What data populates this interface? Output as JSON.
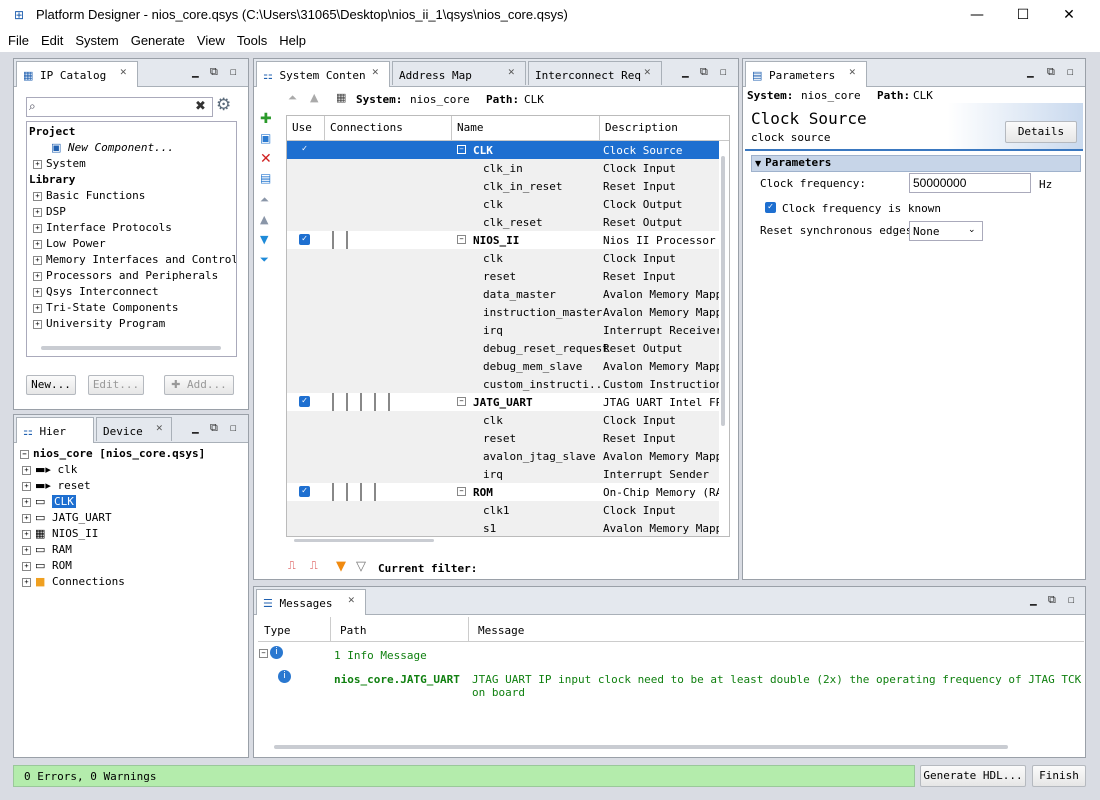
{
  "window": {
    "title": "Platform Designer - nios_core.qsys (C:\\Users\\31065\\Desktop\\nios_ii_1\\qsys\\nios_core.qsys)",
    "minimize": "—",
    "maximize": "☐",
    "close": "✕"
  },
  "menu": [
    "File",
    "Edit",
    "System",
    "Generate",
    "View",
    "Tools",
    "Help"
  ],
  "ip_catalog": {
    "tab": "IP Catalog",
    "search_placeholder": "",
    "project_heading": "Project",
    "new_component": "New Component...",
    "system": "System",
    "library_heading": "Library",
    "library_items": [
      "Basic Functions",
      "DSP",
      "Interface Protocols",
      "Low Power",
      "Memory Interfaces and Controllers",
      "Processors and Peripherals",
      "Qsys Interconnect",
      "Tri-State Components",
      "University Program"
    ],
    "buttons": {
      "new": "New...",
      "edit": "Edit...",
      "add": "Add..."
    }
  },
  "hierarchy": {
    "tabs": [
      "Hier",
      "Device"
    ],
    "root": "nios_core [nios_core.qsys]",
    "items": [
      "clk",
      "reset",
      "CLK",
      "JATG_UART",
      "NIOS_II",
      "RAM",
      "ROM",
      "Connections"
    ]
  },
  "system_contents": {
    "tabs": [
      "System Conten",
      "Address Map",
      "Interconnect Req"
    ],
    "system_label": "System:",
    "system_name": "nios_core",
    "path_label": "Path:",
    "path_value": "CLK",
    "columns": [
      "Use",
      "Connections",
      "Name",
      "Description"
    ],
    "rows": [
      {
        "use": true,
        "name": "CLK",
        "desc": "Clock Source",
        "module": true,
        "selected": true
      },
      {
        "use": false,
        "name": "clk_in",
        "desc": "Clock Input"
      },
      {
        "use": false,
        "name": "clk_in_reset",
        "desc": "Reset Input"
      },
      {
        "use": false,
        "name": "clk",
        "desc": "Clock Output"
      },
      {
        "use": false,
        "name": "clk_reset",
        "desc": "Reset Output"
      },
      {
        "use": true,
        "name": "NIOS_II",
        "desc": "Nios II Processor",
        "module": true
      },
      {
        "use": false,
        "name": "clk",
        "desc": "Clock Input"
      },
      {
        "use": false,
        "name": "reset",
        "desc": "Reset Input"
      },
      {
        "use": false,
        "name": "data_master",
        "desc": "Avalon Memory Mappe"
      },
      {
        "use": false,
        "name": "instruction_master",
        "desc": "Avalon Memory Mappe"
      },
      {
        "use": false,
        "name": "irq",
        "desc": "Interrupt Receiver"
      },
      {
        "use": false,
        "name": "debug_reset_request",
        "desc": "Reset Output"
      },
      {
        "use": false,
        "name": "debug_mem_slave",
        "desc": "Avalon Memory Mappe"
      },
      {
        "use": false,
        "name": "custom_instructi...",
        "desc": "Custom Instruction"
      },
      {
        "use": true,
        "name": "JATG_UART",
        "desc": "JTAG UART Intel FPG",
        "module": true
      },
      {
        "use": false,
        "name": "clk",
        "desc": "Clock Input"
      },
      {
        "use": false,
        "name": "reset",
        "desc": "Reset Input"
      },
      {
        "use": false,
        "name": "avalon_jtag_slave",
        "desc": "Avalon Memory Mappe"
      },
      {
        "use": false,
        "name": "irq",
        "desc": "Interrupt Sender"
      },
      {
        "use": true,
        "name": "ROM",
        "desc": "On-Chip Memory (RAM",
        "module": true
      },
      {
        "use": false,
        "name": "clk1",
        "desc": "Clock Input"
      },
      {
        "use": false,
        "name": "s1",
        "desc": "Avalon Memory Mappe"
      }
    ],
    "filter_label": "Current filter:"
  },
  "parameters": {
    "tab": "Parameters",
    "system_label": "System:",
    "system_name": "nios_core",
    "path_label": "Path:",
    "path_value": "CLK",
    "component_title": "Clock Source",
    "component_sub": "clock source",
    "details_button": "Details",
    "section": "Parameters",
    "clock_freq_label": "Clock frequency:",
    "clock_freq_value": "50000000",
    "clock_freq_unit": "Hz",
    "clock_known_label": "Clock frequency is known",
    "reset_sync_label": "Reset synchronous edges:",
    "reset_sync_value": "None"
  },
  "messages": {
    "tab": "Messages",
    "columns": [
      "Type",
      "Path",
      "Message"
    ],
    "summary": "1 Info Message",
    "path": "nios_core.JATG_UART",
    "text": "JTAG UART IP input clock need to be at least double (2x) the operating frequency of JTAG TCK on board"
  },
  "status": {
    "text": "0 Errors, 0 Warnings",
    "generate": "Generate HDL...",
    "finish": "Finish"
  }
}
